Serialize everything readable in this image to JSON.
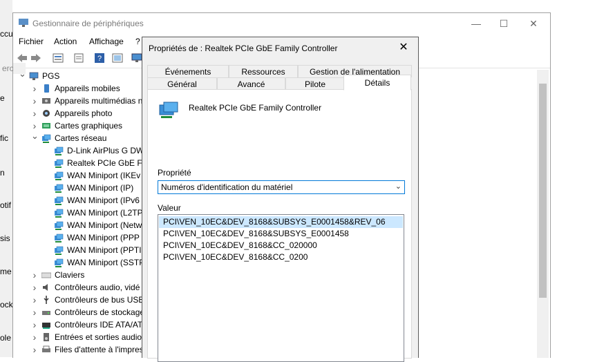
{
  "background_window": {
    "fragments": [
      "ccu",
      "e",
      "fic",
      "n",
      "otif",
      "sis",
      "me",
      "ock",
      "ole"
    ]
  },
  "device_manager": {
    "title": "Gestionnaire de périphériques",
    "window_buttons": [
      "—",
      "☐",
      "✕"
    ],
    "menu": [
      "Fichier",
      "Action",
      "Affichage",
      "?"
    ],
    "search_fragment": "erc",
    "tree": {
      "root": "PGS",
      "categories_before": [
        {
          "label": "Appareils mobiles",
          "icon": "mobile-device-icon"
        },
        {
          "label": "Appareils multimédias n",
          "icon": "multimedia-icon"
        },
        {
          "label": "Appareils photo",
          "icon": "camera-icon"
        },
        {
          "label": "Cartes graphiques",
          "icon": "display-adapter-icon"
        }
      ],
      "network": {
        "label": "Cartes réseau",
        "children": [
          "D-Link AirPlus G DW",
          "Realtek PCIe GbE Fa",
          "WAN Miniport (IKEv",
          "WAN Miniport (IP)",
          "WAN Miniport (IPv6",
          "WAN Miniport (L2TP",
          "WAN Miniport (Netw",
          "WAN Miniport (PPP",
          "WAN Miniport (PPTI",
          "WAN Miniport (SSTP"
        ]
      },
      "categories_after": [
        {
          "label": "Claviers",
          "icon": "keyboard-icon"
        },
        {
          "label": "Contrôleurs audio, vidé",
          "icon": "audio-icon"
        },
        {
          "label": "Contrôleurs de bus USB",
          "icon": "usb-icon"
        },
        {
          "label": "Contrôleurs de stockage",
          "icon": "storage-icon"
        },
        {
          "label": "Contrôleurs IDE ATA/ATA",
          "icon": "ide-icon"
        },
        {
          "label": "Entrées et sorties audio",
          "icon": "speaker-icon"
        },
        {
          "label": "Files d'attente à l'impres",
          "icon": "printer-icon"
        }
      ]
    }
  },
  "dialog": {
    "title": "Propriétés de : Realtek PCIe GbE Family Controller",
    "close": "✕",
    "tabs_row1": [
      "Événements",
      "Ressources",
      "Gestion de l'alimentation"
    ],
    "tabs_row2": [
      "Général",
      "Avancé",
      "Pilote",
      "Détails"
    ],
    "active_tab": "Détails",
    "device_name": "Realtek PCIe GbE Family Controller",
    "property_label": "Propriété",
    "property_value": "Numéros d'identification du matériel",
    "value_label": "Valeur",
    "values": [
      "PCI\\VEN_10EC&DEV_8168&SUBSYS_E0001458&REV_06",
      "PCI\\VEN_10EC&DEV_8168&SUBSYS_E0001458",
      "PCI\\VEN_10EC&DEV_8168&CC_020000",
      "PCI\\VEN_10EC&DEV_8168&CC_0200"
    ],
    "selected_index": 0
  },
  "colors": {
    "accent": "#0078d7",
    "selection": "#cce8ff",
    "dialog_bg": "#f0f0f0"
  }
}
